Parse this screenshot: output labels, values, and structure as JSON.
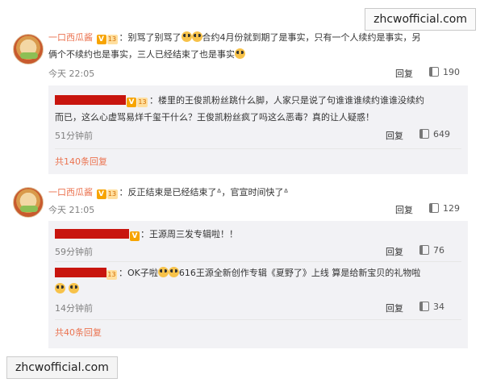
{
  "watermark": {
    "text": "zhcwofficial.com"
  },
  "comments": [
    {
      "username": "一口西瓜酱",
      "verified_badge": "V",
      "level_badge": "13",
      "text_line1_a": "：别骂了别骂了",
      "text_line1_b": "合约4月份就到期了是事实，只有一个人续约是事实，另",
      "text_line2": "俩个不续约也是事实，三人已经结束了也是事实",
      "time": "今天 22:05",
      "reply_label": "回复",
      "like_count": "190",
      "replies": [
        {
          "text_line1": "：楼里的王俊凯粉丝跳什么脚，人家只是说了句谁谁谁续约谁谁没续约",
          "text_line2": "而已，这么心虚骂易烊千玺干什么？王俊凯粉丝疯了吗这么恶毒？真的让人疑惑！",
          "time": "51分钟前",
          "reply_label": "回复",
          "like_count": "649"
        }
      ],
      "more_replies": "共140条回复"
    },
    {
      "username": "一口西瓜酱",
      "verified_badge": "V",
      "level_badge": "13",
      "text_line1": "：反正结束是已经结束了",
      "text_line1_b": "，官宣时间快了",
      "kaomoji": "ᐞ",
      "time": "今天 21:05",
      "reply_label": "回复",
      "like_count": "129",
      "replies": [
        {
          "text_line1": "：王源周三发专辑啦！！",
          "time": "59分钟前",
          "reply_label": "回复",
          "like_count": "76"
        },
        {
          "text_line1_a": "：OK子啦",
          "text_line1_b": "616王源全新创作专辑《夏野了》上线 算是给新宝贝的礼物啦",
          "time": "14分钟前",
          "reply_label": "回复",
          "like_count": "34"
        }
      ],
      "more_replies": "共40条回复"
    }
  ],
  "colors": {
    "username": "#eb7350",
    "redaction": "#c8150e",
    "reply_bg": "#f2f2f5",
    "verified": "#f7a400"
  }
}
